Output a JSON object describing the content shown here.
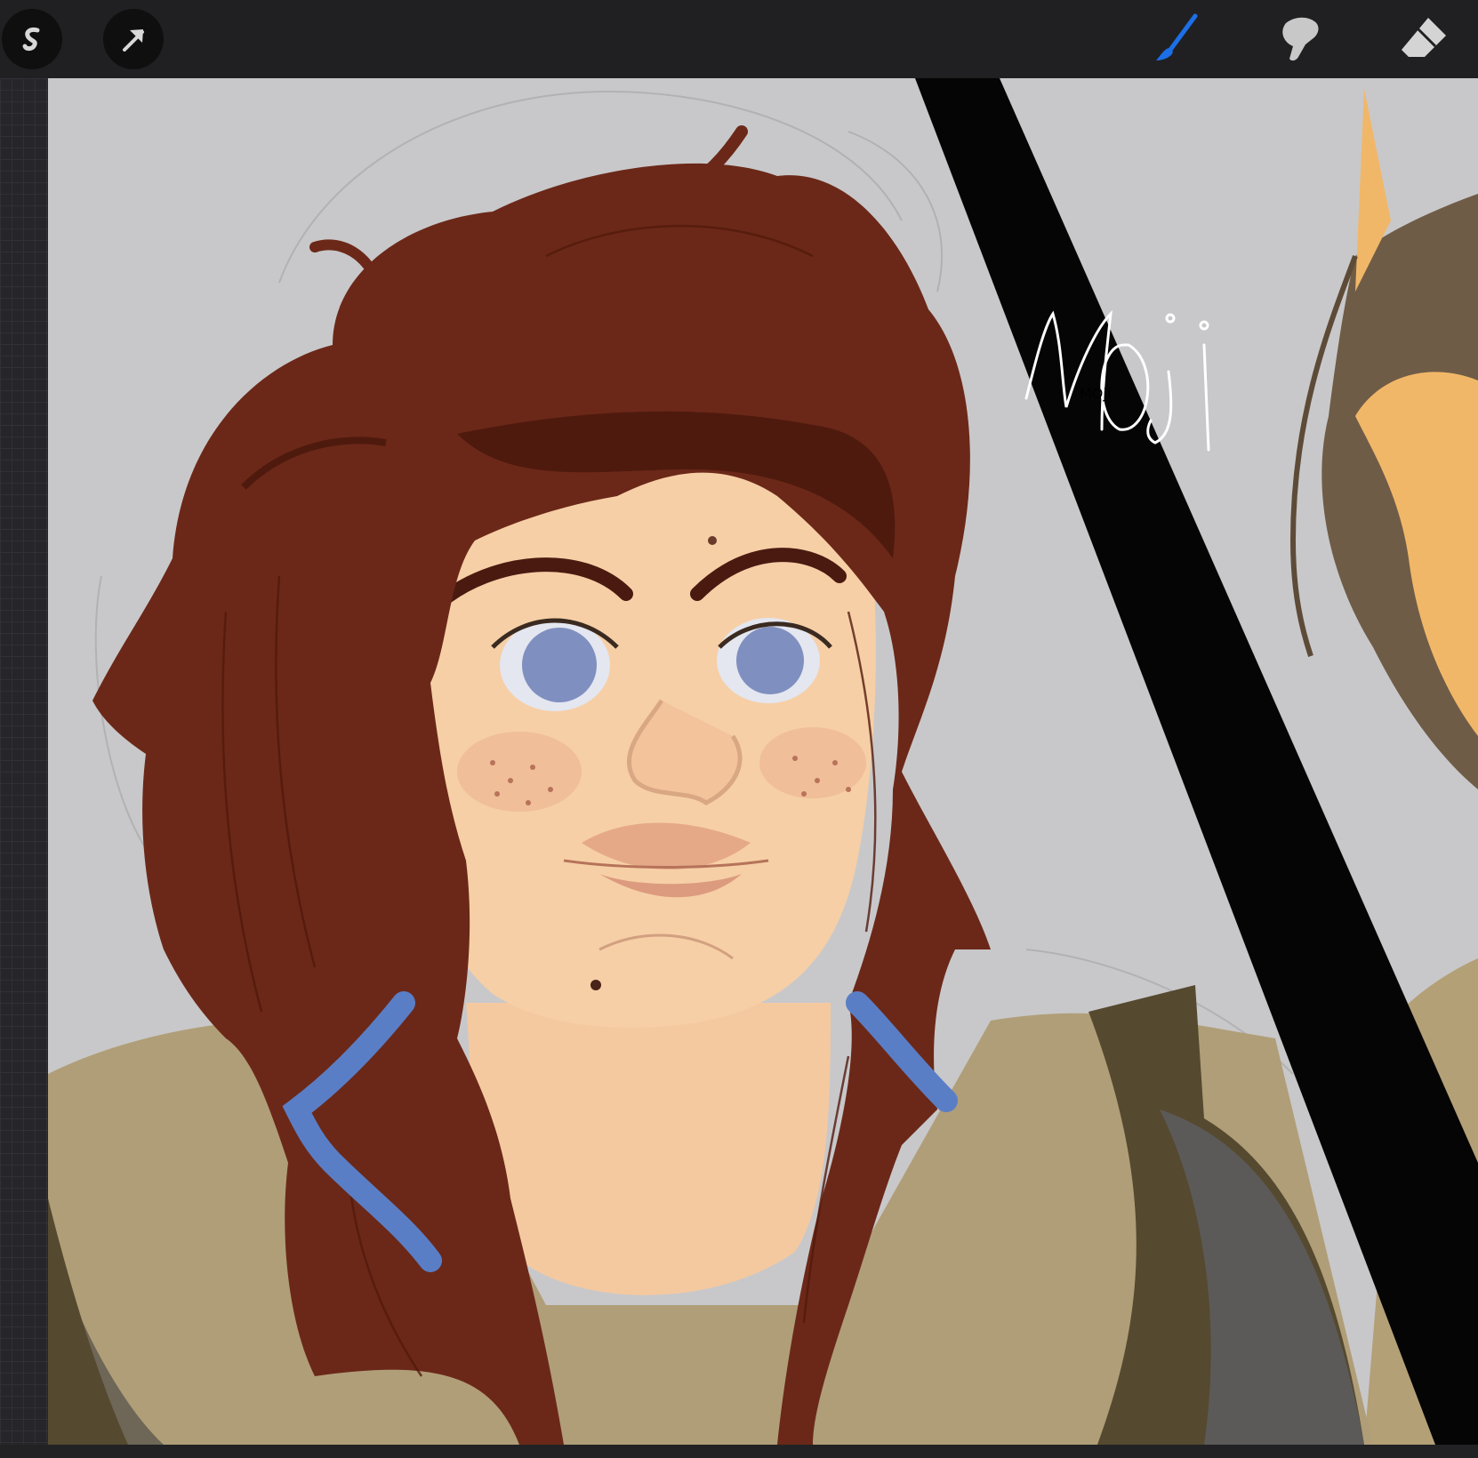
{
  "app": {
    "toolbar": {
      "gallery_icon": "procreate-logo-icon",
      "transform_icon": "transform-arrow-icon",
      "brush_icon": "brush-icon",
      "smudge_icon": "smudge-icon",
      "eraser_icon": "eraser-icon",
      "active_tool": "brush",
      "accent_color": "#1c6fe6"
    }
  },
  "canvas": {
    "signature": "MOji",
    "background_color": "#c8c8ca",
    "hair_color": "#6b2818",
    "skin_color": "#f6cfa6",
    "eye_color": "#7f8fbf",
    "hair_tie_color": "#5a7ec6",
    "shirt_color": "#b09e78"
  }
}
